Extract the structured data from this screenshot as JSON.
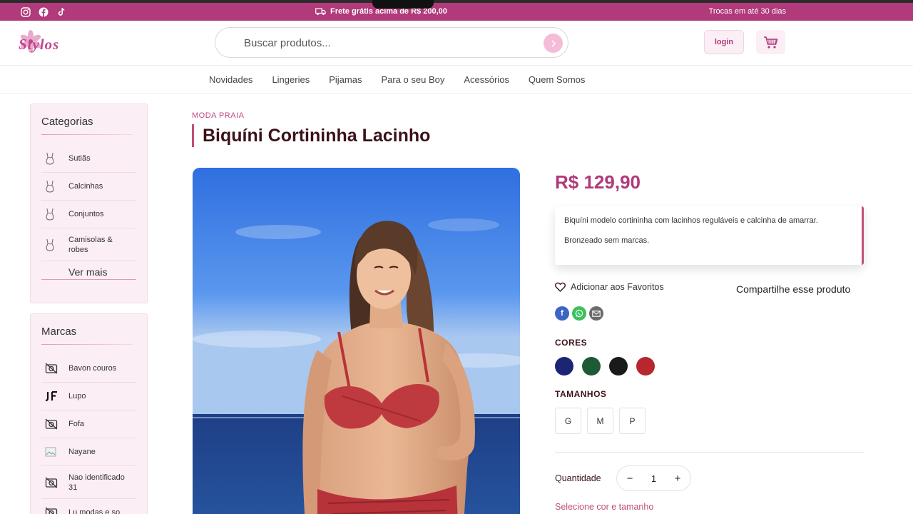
{
  "promo_bar": {
    "social_icons": [
      "instagram-icon",
      "facebook-icon",
      "tiktok-icon"
    ],
    "shipping_text": "Frete grátis acima de R$ 200,00",
    "exchange_text": "Trocas em até 30 dias"
  },
  "header": {
    "logo_text": "Stylos",
    "search_placeholder": "Buscar produtos...",
    "login_label": "login"
  },
  "nav": {
    "items": [
      "Novidades",
      "Lingeries",
      "Pijamas",
      "Para o seu Boy",
      "Acessórios",
      "Quem Somos"
    ]
  },
  "categories": {
    "title": "Categorias",
    "items": [
      "Sutiãs",
      "Calcinhas",
      "Conjuntos",
      "Camisolas & robes"
    ],
    "more_label": "Ver mais"
  },
  "brands": {
    "title": "Marcas",
    "items": [
      "Bavon couros",
      "Lupo",
      "Fofa",
      "Nayane",
      "Nao identificado 31",
      "Lu modas e so"
    ]
  },
  "product": {
    "category": "MODA PRAIA",
    "name": "Biquíni Cortininha Lacinho",
    "price": "R$ 129,90",
    "description": [
      "Biquíni modelo cortininha com lacinhos reguláveis e calcinha de amarrar.",
      "Bronzeado sem marcas."
    ],
    "favorite_label": "Adicionar aos Favoritos",
    "share_label": "Compartilhe esse produto",
    "colors_label": "CORES",
    "colors": [
      "#1c2474",
      "#1f5a36",
      "#1a1a1a",
      "#b8262e"
    ],
    "sizes_label": "TAMANHOS",
    "sizes": [
      "G",
      "M",
      "P"
    ],
    "quantity_label": "Quantidade",
    "quantity": "1",
    "minus": "−",
    "plus": "+",
    "select_hint": "Selecione cor e tamanho"
  },
  "colors": {
    "accent": "#b03a7a",
    "accent_dark": "#3b1218",
    "sidebar_bg": "#fbeef5"
  }
}
